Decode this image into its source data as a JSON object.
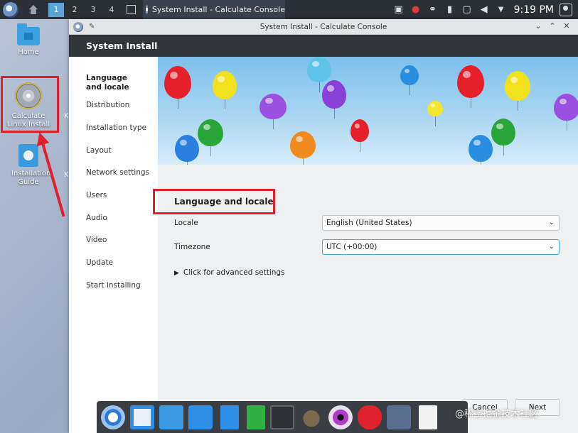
{
  "panel": {
    "desktops": [
      "1",
      "2",
      "3",
      "4"
    ],
    "active_desktop": "1",
    "task_title": "System Install - Calculate Console",
    "clock": "9:19 PM",
    "tray_icons": [
      "clipboard-icon",
      "update-strawberry-icon",
      "network-icon",
      "usb-drive-icon",
      "display-icon",
      "volume-icon",
      "expand-arrow-icon"
    ]
  },
  "desktop_icons": {
    "home": "Home",
    "calculate_install": "Calculate Linux Install",
    "installation_guide": "Installation Guide",
    "partial_label_1": "K",
    "partial_label_2": "K"
  },
  "window": {
    "title": "System Install - Calculate Console",
    "header": "System Install",
    "sidebar": [
      {
        "label": "Language and locale",
        "active": true
      },
      {
        "label": "Distribution",
        "active": false
      },
      {
        "label": "Installation type",
        "active": false
      },
      {
        "label": "Layout",
        "active": false
      },
      {
        "label": "Network settings",
        "active": false
      },
      {
        "label": "Users",
        "active": false
      },
      {
        "label": "Audio",
        "active": false
      },
      {
        "label": "Video",
        "active": false
      },
      {
        "label": "Update",
        "active": false
      },
      {
        "label": "Start installing",
        "active": false
      }
    ],
    "section_title": "Language and locale",
    "locale_label": "Locale",
    "locale_value": "English (United States)",
    "timezone_label": "Timezone",
    "timezone_value": "UTC (+00:00)",
    "advanced_link": "Click for advanced settings",
    "cancel_label": "Cancel",
    "next_label": "Next"
  },
  "colors": {
    "highlight": "#e0202a",
    "header_bg": "#32363b",
    "focus": "#3daee9"
  },
  "dock_icons": [
    "chromium-icon",
    "mail-icon",
    "remote-desktop-icon",
    "messenger-icon",
    "document-icon",
    "spreadsheet-icon",
    "calculator-icon",
    "gimp-icon",
    "eye-of-gnome-icon",
    "strawberry-icon",
    "settings-tools-icon",
    "text-editor-icon"
  ],
  "watermark": "@稀土掘金技术社区"
}
